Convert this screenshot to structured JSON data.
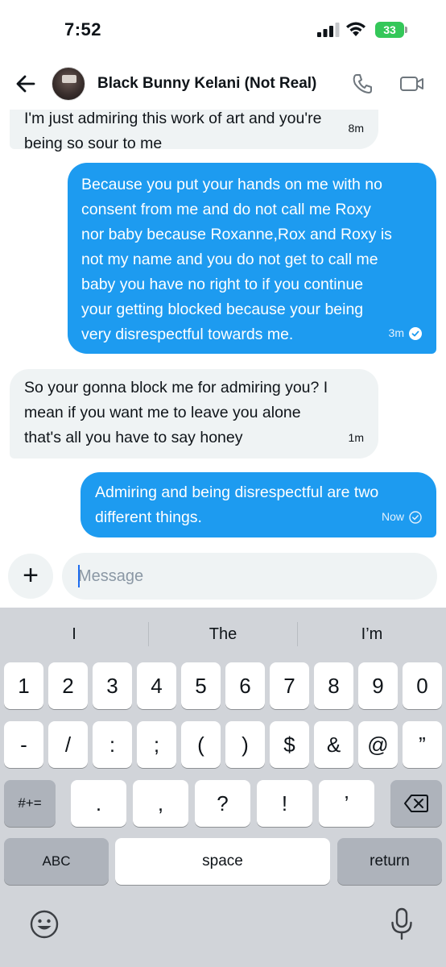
{
  "status_bar": {
    "time": "7:52",
    "battery": "33",
    "battery_color": "#34c759"
  },
  "header": {
    "contact_name": "Black Bunny Kelani (Not Real)",
    "icons": [
      "arrow-left-icon",
      "avatar",
      "phone-icon",
      "video-camera-icon"
    ]
  },
  "messages": [
    {
      "direction": "incoming",
      "text": "I'm just admiring this work of art and you're\nbeing so sour to me",
      "time": "8m"
    },
    {
      "direction": "outgoing",
      "text": "Because you put your hands on me with no\nconsent from me and do not call me Roxy\nnor baby because Roxanne,Rox and Roxy is\nnot my name and you do not get to call me\nbaby you have no right to if you continue\nyour getting blocked because your being\nvery disrespectful towards me.",
      "time": "3m",
      "status_icon": "read-check-icon"
    },
    {
      "direction": "incoming",
      "text": "So your gonna block me for admiring you? I\nmean if you want me to leave you alone\nthat's all you have to say honey",
      "time": "1m"
    },
    {
      "direction": "outgoing",
      "text": "Admiring and being disrespectful are two\ndifferent things.",
      "time": "Now",
      "status_icon": "sent-check-icon"
    }
  ],
  "composer": {
    "placeholder": "Message",
    "add_label": "+"
  },
  "keyboard": {
    "suggestions": [
      "I",
      "The",
      "I’m"
    ],
    "row1": [
      "1",
      "2",
      "3",
      "4",
      "5",
      "6",
      "7",
      "8",
      "9",
      "0"
    ],
    "row2": [
      "-",
      "/",
      ":",
      ";",
      "(",
      ")",
      "$",
      "&",
      "@",
      "”"
    ],
    "row3": [
      ".",
      ",",
      "?",
      "!",
      "’"
    ],
    "symbols_key": "#+=",
    "abc_key": "ABC",
    "space_key": "space",
    "return_key": "return"
  },
  "colors": {
    "outgoing_bubble": "#1d9bf0",
    "incoming_bubble": "#eff3f4",
    "keyboard_bg": "#d1d4d9"
  }
}
